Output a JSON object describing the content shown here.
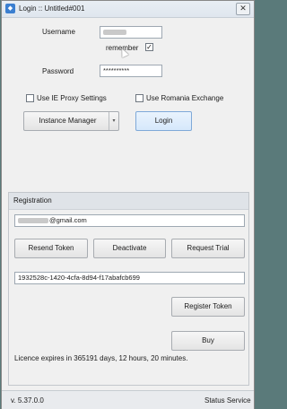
{
  "window": {
    "title": "Login :: Untitled#001",
    "close_glyph": "✕",
    "app_icon": "app-icon"
  },
  "login": {
    "username_label": "Username",
    "username_value_suffix": "",
    "remember_label": "remember",
    "remember_checked": true,
    "password_label": "Password",
    "password_value": "**********",
    "ie_proxy_label": "Use IE Proxy Settings",
    "ie_proxy_checked": false,
    "romania_label": "Use Romania Exchange",
    "romania_checked": false,
    "instance_manager_label": "Instance Manager",
    "dropdown_glyph": "▾",
    "login_button": "Login"
  },
  "registration": {
    "title": "Registration",
    "email_suffix": "@gmail.com",
    "resend_token": "Resend Token",
    "deactivate": "Deactivate",
    "request_trial": "Request Trial",
    "token_value": "1932528c-1420-4cfa-8d94-f17abafcb699",
    "register_token": "Register Token",
    "buy": "Buy",
    "licence_text": "Licence expires in 365191 days, 12 hours, 20 minutes."
  },
  "status": {
    "version": "v. 5.37.0.0",
    "service": "Status Service"
  },
  "colors": {
    "primary_button": "#d6e8fb",
    "accent": "#3b7fd0"
  }
}
